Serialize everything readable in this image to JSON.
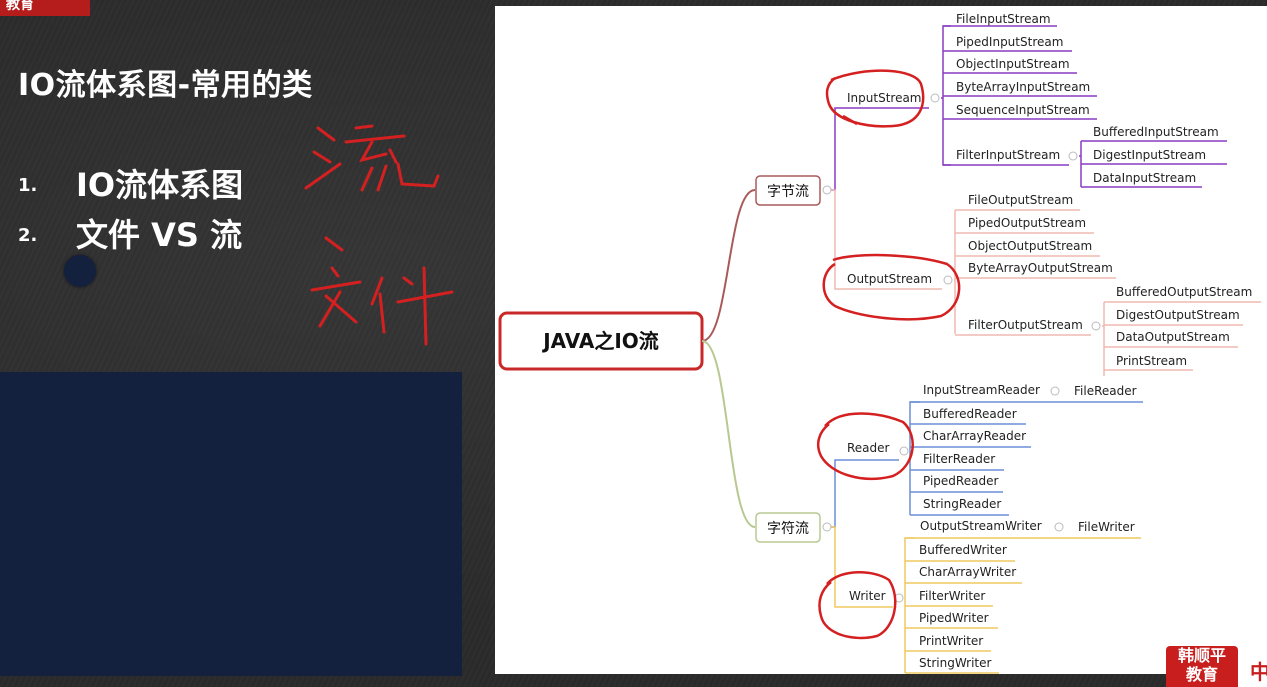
{
  "corner_tab": {
    "label": "教育"
  },
  "slide": {
    "title": "IO流体系图-常用的类",
    "items": [
      {
        "num": "1.",
        "text": "IO流体系图"
      },
      {
        "num": "2.",
        "text": "文件 VS 流"
      }
    ]
  },
  "handwriting": {
    "note1": "流",
    "note2": "文件"
  },
  "diagram": {
    "root": "JAVA之IO流",
    "byte_stream": "字节流",
    "char_stream": "字符流",
    "input_stream": "InputStream",
    "output_stream": "OutputStream",
    "reader": "Reader",
    "writer": "Writer",
    "input_children": [
      "FileInputStream",
      "PipedInputStream",
      "ObjectInputStream",
      "ByteArrayInputStream",
      "SequenceInputStream"
    ],
    "filter_input": "FilterInputStream",
    "filter_input_children": [
      "BufferedInputStream",
      "DigestInputStream",
      "DataInputStream"
    ],
    "output_children": [
      "FileOutputStream",
      "PipedOutputStream",
      "ObjectOutputStream",
      "ByteArrayOutputStream"
    ],
    "filter_output": "FilterOutputStream",
    "filter_output_children": [
      "BufferedOutputStream",
      "DigestOutputStream",
      "DataOutputStream",
      "PrintStream"
    ],
    "input_stream_reader": "InputStreamReader",
    "file_reader": "FileReader",
    "reader_children": [
      "BufferedReader",
      "CharArrayReader",
      "FilterReader",
      "PipedReader",
      "StringReader"
    ],
    "output_stream_writer": "OutputStreamWriter",
    "file_writer": "FileWriter",
    "writer_children": [
      "BufferedWriter",
      "CharArrayWriter",
      "FilterWriter",
      "PipedWriter",
      "PrintWriter",
      "StringWriter"
    ]
  },
  "logo": {
    "line1": "韩顺平",
    "line2": "教育",
    "tail": "中"
  },
  "colors": {
    "red_annotation": "#d42020",
    "input_branch": "#8a3bc4",
    "output_branch": "#f0b8b0",
    "reader_branch": "#6a8fd8",
    "writer_branch": "#f0c860",
    "root_border": "#c82828",
    "byte_link": "#a85a5a",
    "char_link": "#b8c890",
    "panel": "#13213f"
  }
}
